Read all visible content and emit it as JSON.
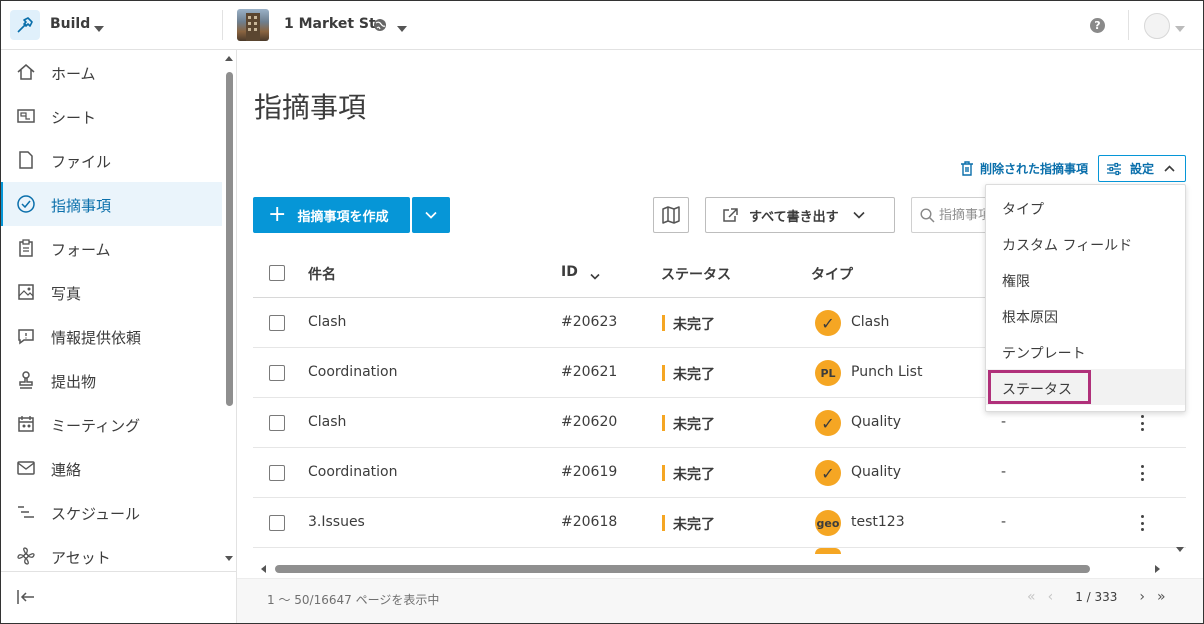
{
  "topbar": {
    "app_name": "Build",
    "project_name": "1 Market St.",
    "help_glyph": "?"
  },
  "sidebar": {
    "items": [
      {
        "label": "ホーム",
        "icon": "home-icon"
      },
      {
        "label": "シート",
        "icon": "sheet-icon"
      },
      {
        "label": "ファイル",
        "icon": "file-icon"
      },
      {
        "label": "指摘事項",
        "icon": "check-circle-icon",
        "active": true
      },
      {
        "label": "フォーム",
        "icon": "clipboard-icon"
      },
      {
        "label": "写真",
        "icon": "photo-icon"
      },
      {
        "label": "情報提供依頼",
        "icon": "chat-question-icon"
      },
      {
        "label": "提出物",
        "icon": "stamp-icon"
      },
      {
        "label": "ミーティング",
        "icon": "calendar-people-icon"
      },
      {
        "label": "連絡",
        "icon": "mail-icon"
      },
      {
        "label": "スケジュール",
        "icon": "schedule-icon"
      },
      {
        "label": "アセット",
        "icon": "asset-icon"
      }
    ]
  },
  "main": {
    "title": "指摘事項",
    "deleted_link": "削除された指摘事項",
    "settings_label": "設定",
    "create_label": "指摘事項を作成",
    "export_label": "すべて書き出す",
    "search_placeholder": "指摘事項"
  },
  "table": {
    "headers": {
      "name": "件名",
      "id": "ID",
      "status": "ステータス",
      "type": "タイプ"
    },
    "rows": [
      {
        "name": "Clash",
        "id": "#20623",
        "status": "未完了",
        "badge": "✓",
        "type": "Clash",
        "extra": ""
      },
      {
        "name": "Coordination",
        "id": "#20621",
        "status": "未完了",
        "badge": "PL",
        "type": "Punch List",
        "extra": ""
      },
      {
        "name": "Clash",
        "id": "#20620",
        "status": "未完了",
        "badge": "✓",
        "type": "Quality",
        "extra": "-"
      },
      {
        "name": "Coordination",
        "id": "#20619",
        "status": "未完了",
        "badge": "✓",
        "type": "Quality",
        "extra": "-"
      },
      {
        "name": "3.Issues",
        "id": "#20618",
        "status": "未完了",
        "badge": "geo",
        "type": "test123",
        "extra": "-"
      }
    ]
  },
  "footer": {
    "info": "1 ～ 50/16647 ページを表示中",
    "page": "1 / 333"
  },
  "settings_menu": {
    "items": [
      "タイプ",
      "カスタム フィールド",
      "権限",
      "根本原因",
      "テンプレート",
      "ステータス"
    ],
    "highlighted": "ステータス"
  },
  "colors": {
    "accent": "#0696d7",
    "status_open": "#f5a623",
    "highlight_box": "#b0307a"
  }
}
